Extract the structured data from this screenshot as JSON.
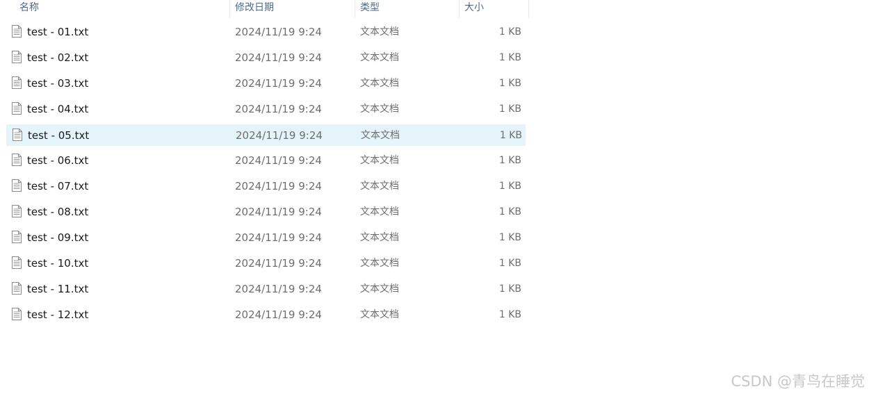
{
  "columns": {
    "name": "名称",
    "date": "修改日期",
    "type": "类型",
    "size": "大小"
  },
  "files": [
    {
      "name": "test - 01.txt",
      "date": "2024/11/19 9:24",
      "type": "文本文档",
      "size": "1 KB"
    },
    {
      "name": "test - 02.txt",
      "date": "2024/11/19 9:24",
      "type": "文本文档",
      "size": "1 KB"
    },
    {
      "name": "test - 03.txt",
      "date": "2024/11/19 9:24",
      "type": "文本文档",
      "size": "1 KB"
    },
    {
      "name": "test - 04.txt",
      "date": "2024/11/19 9:24",
      "type": "文本文档",
      "size": "1 KB"
    },
    {
      "name": "test - 05.txt",
      "date": "2024/11/19 9:24",
      "type": "文本文档",
      "size": "1 KB",
      "highlighted": true
    },
    {
      "name": "test - 06.txt",
      "date": "2024/11/19 9:24",
      "type": "文本文档",
      "size": "1 KB"
    },
    {
      "name": "test - 07.txt",
      "date": "2024/11/19 9:24",
      "type": "文本文档",
      "size": "1 KB"
    },
    {
      "name": "test - 08.txt",
      "date": "2024/11/19 9:24",
      "type": "文本文档",
      "size": "1 KB"
    },
    {
      "name": "test - 09.txt",
      "date": "2024/11/19 9:24",
      "type": "文本文档",
      "size": "1 KB"
    },
    {
      "name": "test - 10.txt",
      "date": "2024/11/19 9:24",
      "type": "文本文档",
      "size": "1 KB"
    },
    {
      "name": "test - 11.txt",
      "date": "2024/11/19 9:24",
      "type": "文本文档",
      "size": "1 KB"
    },
    {
      "name": "test - 12.txt",
      "date": "2024/11/19 9:24",
      "type": "文本文档",
      "size": "1 KB"
    }
  ],
  "icon": "text-file-icon",
  "colors": {
    "highlight": "#e5f3fb",
    "header_text": "#4d6b8a",
    "secondary_text": "#6d6d6d"
  },
  "watermark": "CSDN @青鸟在睡觉"
}
